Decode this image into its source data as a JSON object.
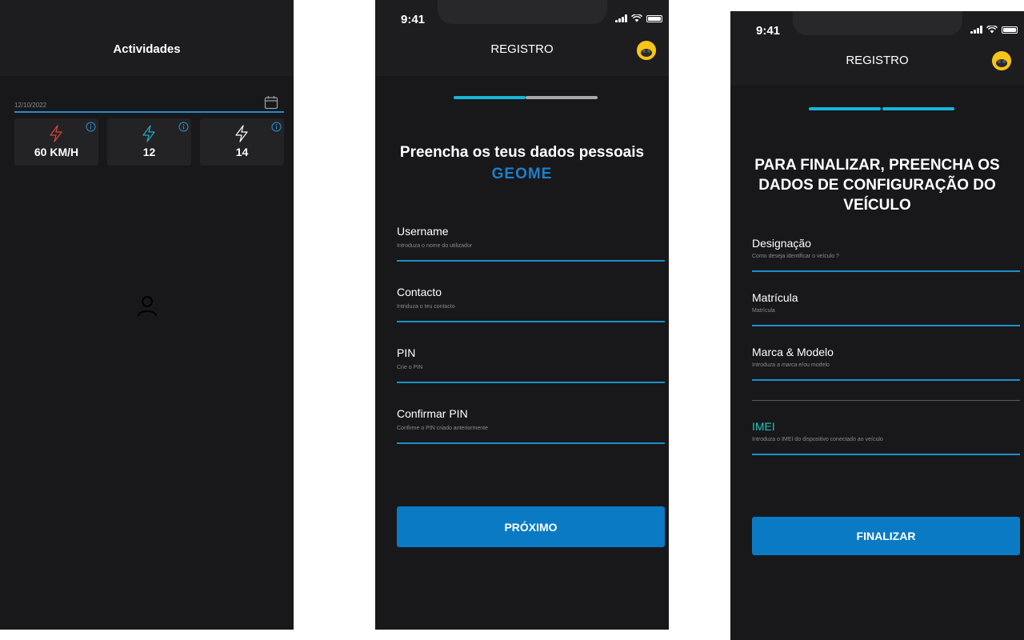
{
  "colors": {
    "background": "#18181b",
    "header": "#1d1d20",
    "accent_blue": "#1e8fc9",
    "button_blue": "#0a7ac4",
    "brand_blue": "#1e7fc9",
    "progress_cyan": "#17b6d6",
    "progress_grey": "#a8a8aa",
    "imei_teal": "#22c7b8",
    "speed_red": "#e0433a",
    "bolt_cyan": "#27a9c8",
    "bolt_white": "#ffffff"
  },
  "activities": {
    "title": "Actividades",
    "date": "12/10/2022",
    "stats": [
      {
        "value": "60 KM/H",
        "icon": "bolt-red-icon"
      },
      {
        "value": "12",
        "icon": "bolt-cyan-icon"
      },
      {
        "value": "14",
        "icon": "bolt-white-icon"
      }
    ]
  },
  "registro1": {
    "status_time": "9:41",
    "title": "REGISTRO",
    "progress": {
      "filled": 1,
      "total": 2
    },
    "heading": "Preencha  os teus dados pessoais",
    "brand": "GEOME",
    "fields": [
      {
        "label": "Username",
        "placeholder": "Introduza o nome do utilizador"
      },
      {
        "label": "Contacto",
        "placeholder": "Intriduza o teu contacto"
      },
      {
        "label": "PIN",
        "placeholder": "Crie o PIN"
      },
      {
        "label": "Confirmar PIN",
        "placeholder": "Confirme o PIN criado anteriormente"
      }
    ],
    "button": "PRÓXIMO"
  },
  "registro2": {
    "status_time": "9:41",
    "title": "REGISTRO",
    "progress": {
      "filled": 2,
      "total": 2
    },
    "heading": "PARA FINALIZAR, PREENCHA OS DADOS DE CONFIGURAÇÃO DO VEÍCULO",
    "fields": [
      {
        "label": "Designação",
        "placeholder": "Como deseja identificar o veículo ?"
      },
      {
        "label": "Matrícula",
        "placeholder": "Matrícula"
      },
      {
        "label": "Marca & Modelo",
        "placeholder": "Introduza a marca e/ou modelo"
      },
      {
        "label": "IMEI",
        "placeholder": "Introduza o IMEI do dispositivo conectado ao veículo"
      }
    ],
    "button": "FINALIZAR"
  }
}
